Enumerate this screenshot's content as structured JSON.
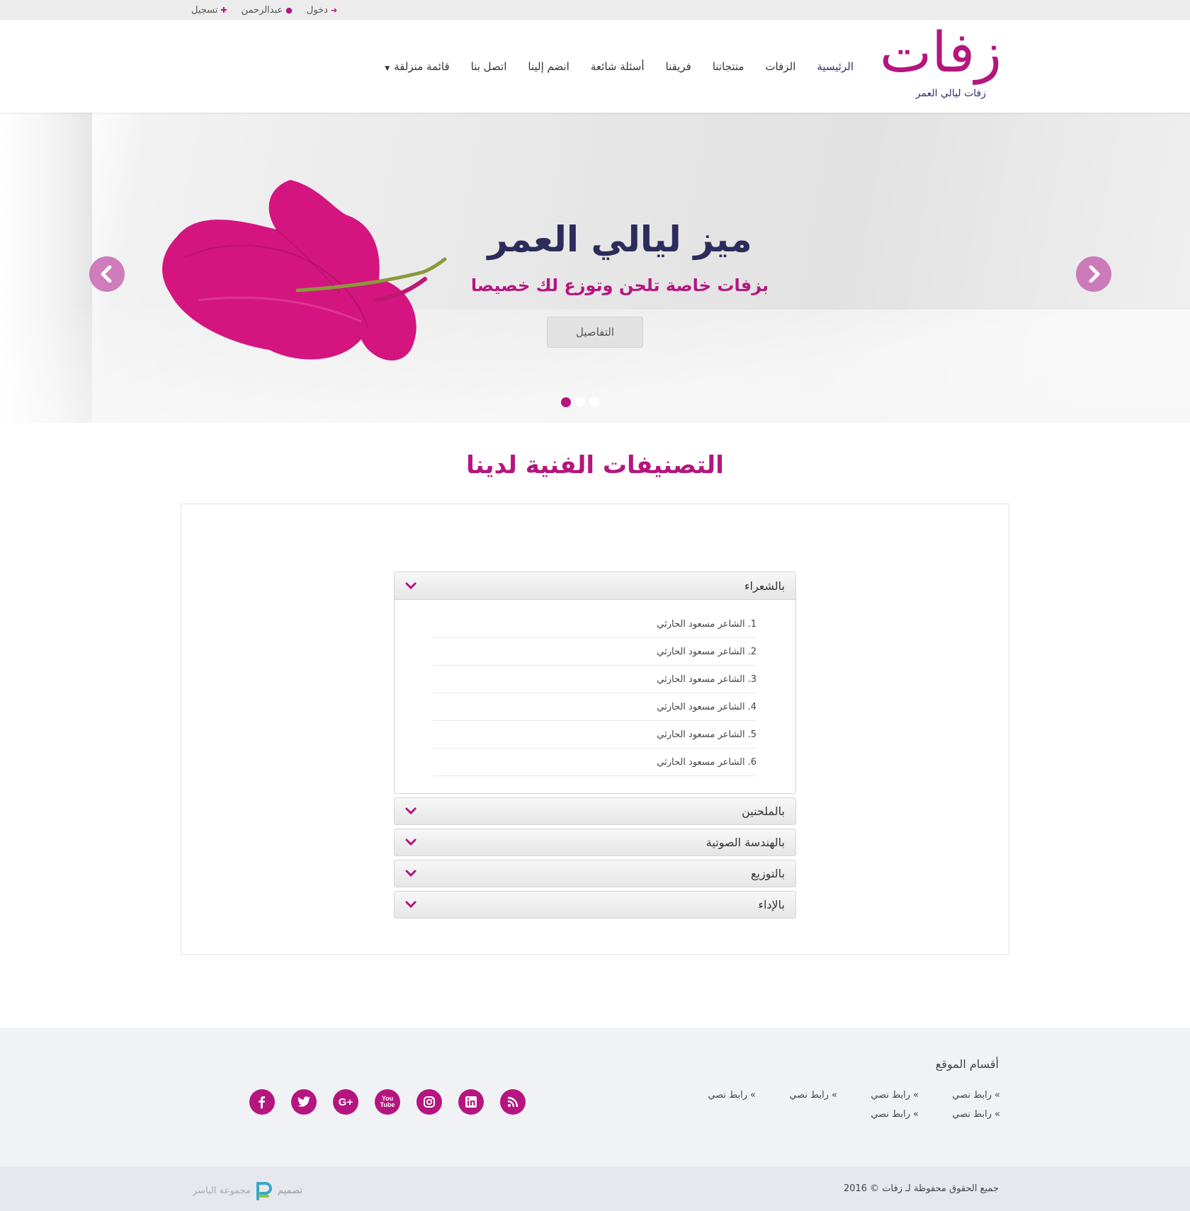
{
  "topbar": {
    "login": "دخول",
    "user": "عبدالرحمن",
    "register": "تسجيل"
  },
  "logo": {
    "main": "زفات",
    "tagline": "زفات ليالي العمر"
  },
  "nav": [
    {
      "label": "الرئيسية",
      "active": true
    },
    {
      "label": "الزفات"
    },
    {
      "label": "منتجاتنا"
    },
    {
      "label": "فريقنا"
    },
    {
      "label": "أسئلة شائعة"
    },
    {
      "label": "انضم إلينا"
    },
    {
      "label": "اتصل بنا"
    },
    {
      "label": "قائمة منزلقة"
    }
  ],
  "hero": {
    "title": "ميز ليالي العمر",
    "subtitle": "بزفات خاصة تلحن وتوزع لك خصيصا",
    "button": "التفاصيل",
    "slides": 3,
    "active_slide": 1
  },
  "section": {
    "title": "التصنيفات الفنية لدينا"
  },
  "accordion": [
    {
      "title": "بالشعراء",
      "open": true,
      "items": [
        {
          "num": "1.",
          "label": "الشاعر مسعود الحارثي"
        },
        {
          "num": "2.",
          "label": "الشاعر مسعود الحارثي"
        },
        {
          "num": "3.",
          "label": "الشاعر مسعود الحارثي"
        },
        {
          "num": "4.",
          "label": "الشاعر مسعود الحارثي"
        },
        {
          "num": "5.",
          "label": "الشاعر مسعود الحارثي"
        },
        {
          "num": "6.",
          "label": "الشاعر مسعود الحارثي"
        }
      ]
    },
    {
      "title": "بالملحنين"
    },
    {
      "title": "بالهندسة الصوتية"
    },
    {
      "title": "بالتوزيع"
    },
    {
      "title": "بالإداء"
    }
  ],
  "footer": {
    "title": "أقسام الموقع",
    "links": [
      "رابط نصي",
      "رابط نصي",
      "رابط نصي",
      "رابط نصي",
      "رابط نصي",
      "رابط نصي"
    ],
    "social": [
      "rss-icon",
      "linkedin-icon",
      "instagram-icon",
      "youtube-icon",
      "google-plus-icon",
      "twitter-icon",
      "facebook-icon"
    ]
  },
  "copyright": {
    "text": "جميع الحقوق محفوظة لـ زفات © 2016",
    "design_label": "تصميم",
    "designer": "مجموعة الياسر"
  },
  "colors": {
    "accent": "#b5157e",
    "navy": "#2c2c6e"
  }
}
